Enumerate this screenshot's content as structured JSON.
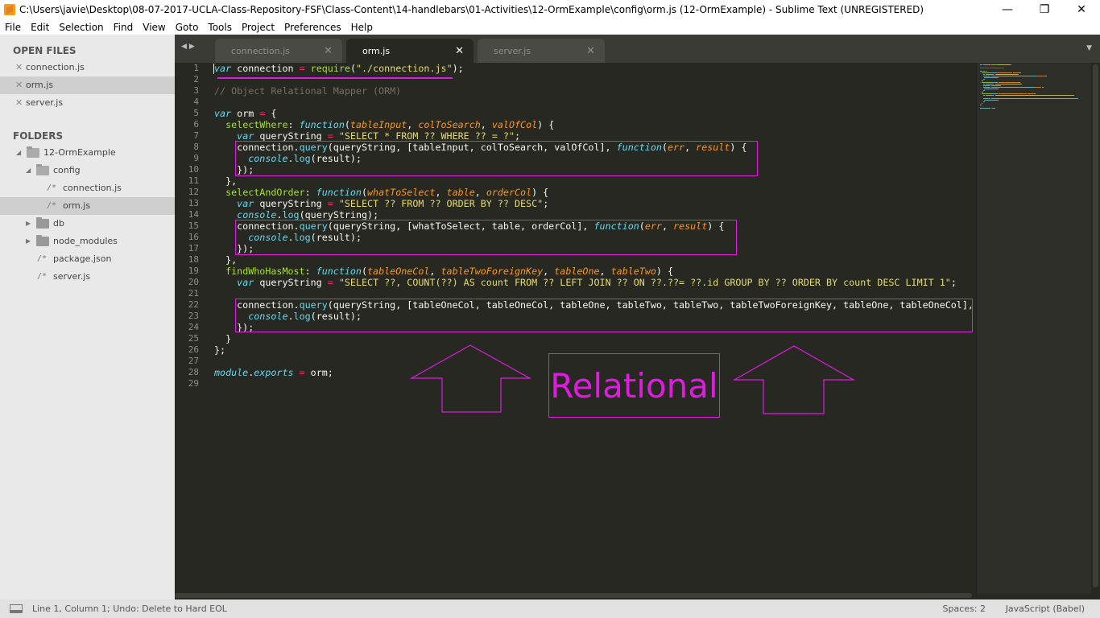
{
  "window": {
    "title": "C:\\Users\\javie\\Desktop\\08-07-2017-UCLA-Class-Repository-FSF\\Class-Content\\14-handlebars\\01-Activities\\12-OrmExample\\config\\orm.js (12-OrmExample) - Sublime Text (UNREGISTERED)",
    "minimize": "—",
    "restore": "❐",
    "close": "✕"
  },
  "menu": [
    "File",
    "Edit",
    "Selection",
    "Find",
    "View",
    "Goto",
    "Tools",
    "Project",
    "Preferences",
    "Help"
  ],
  "sidebar": {
    "open_files_header": "OPEN FILES",
    "open_files": [
      {
        "name": "connection.js",
        "selected": false
      },
      {
        "name": "orm.js",
        "selected": true
      },
      {
        "name": "server.js",
        "selected": false
      }
    ],
    "folders_header": "FOLDERS",
    "tree": [
      {
        "name": "12-OrmExample",
        "type": "folder-open",
        "depth": 0,
        "selected": false
      },
      {
        "name": "config",
        "type": "folder-open",
        "depth": 1,
        "selected": false
      },
      {
        "name": "connection.js",
        "type": "file",
        "depth": 2,
        "selected": false
      },
      {
        "name": "orm.js",
        "type": "file",
        "depth": 2,
        "selected": true
      },
      {
        "name": "db",
        "type": "folder-closed",
        "depth": 1,
        "selected": false
      },
      {
        "name": "node_modules",
        "type": "folder-closed",
        "depth": 1,
        "selected": false
      },
      {
        "name": "package.json",
        "type": "file",
        "depth": 1,
        "selected": false
      },
      {
        "name": "server.js",
        "type": "file",
        "depth": 1,
        "selected": false
      }
    ],
    "close_glyph": "✕",
    "file_glyph": "/*"
  },
  "tabs": [
    {
      "label": "connection.js",
      "active": false
    },
    {
      "label": "orm.js",
      "active": true
    },
    {
      "label": "server.js",
      "active": false
    }
  ],
  "tab_close_glyph": "✕",
  "nav_arrows": "◀▶",
  "tab_menu_glyph": "▼",
  "editor": {
    "line_numbers": [
      "1",
      "2",
      "3",
      "4",
      "5",
      "6",
      "7",
      "8",
      "9",
      "10",
      "11",
      "12",
      "13",
      "14",
      "15",
      "16",
      "17",
      "18",
      "19",
      "20",
      "21",
      "22",
      "23",
      "24",
      "25",
      "26",
      "27",
      "28",
      "29"
    ],
    "code": [
      [
        [
          "kw",
          "var"
        ],
        [
          "t",
          " connection "
        ],
        [
          "op",
          "="
        ],
        [
          "t",
          " "
        ],
        [
          "fn",
          "require"
        ],
        [
          "t",
          "("
        ],
        [
          "str",
          "\"./connection.js\""
        ],
        [
          "t",
          ");"
        ]
      ],
      [],
      [
        [
          "cmt",
          "// Object Relational Mapper (ORM)"
        ]
      ],
      [],
      [
        [
          "kw",
          "var"
        ],
        [
          "t",
          " orm "
        ],
        [
          "op",
          "="
        ],
        [
          "t",
          " {"
        ]
      ],
      [
        [
          "t",
          "  "
        ],
        [
          "fn",
          "selectWhere"
        ],
        [
          "t",
          ": "
        ],
        [
          "kw",
          "function"
        ],
        [
          "t",
          "("
        ],
        [
          "prm",
          "tableInput"
        ],
        [
          "t",
          ", "
        ],
        [
          "prm",
          "colToSearch"
        ],
        [
          "t",
          ", "
        ],
        [
          "prm",
          "valOfCol"
        ],
        [
          "t",
          ") {"
        ]
      ],
      [
        [
          "t",
          "    "
        ],
        [
          "kw",
          "var"
        ],
        [
          "t",
          " queryString "
        ],
        [
          "op",
          "="
        ],
        [
          "t",
          " "
        ],
        [
          "str",
          "\"SELECT * FROM ?? WHERE ?? = ?\""
        ],
        [
          "t",
          ";"
        ]
      ],
      [
        [
          "t",
          "    connection."
        ],
        [
          "mth",
          "query"
        ],
        [
          "t",
          "(queryString, [tableInput, colToSearch, valOfCol], "
        ],
        [
          "kw",
          "function"
        ],
        [
          "t",
          "("
        ],
        [
          "prm",
          "err"
        ],
        [
          "t",
          ", "
        ],
        [
          "prm",
          "result"
        ],
        [
          "t",
          ") {"
        ]
      ],
      [
        [
          "t",
          "      "
        ],
        [
          "sup",
          "console"
        ],
        [
          "t",
          "."
        ],
        [
          "mth",
          "log"
        ],
        [
          "t",
          "(result);"
        ]
      ],
      [
        [
          "t",
          "    });"
        ]
      ],
      [
        [
          "t",
          "  },"
        ]
      ],
      [
        [
          "t",
          "  "
        ],
        [
          "fn",
          "selectAndOrder"
        ],
        [
          "t",
          ": "
        ],
        [
          "kw",
          "function"
        ],
        [
          "t",
          "("
        ],
        [
          "prm",
          "whatToSelect"
        ],
        [
          "t",
          ", "
        ],
        [
          "prm",
          "table"
        ],
        [
          "t",
          ", "
        ],
        [
          "prm",
          "orderCol"
        ],
        [
          "t",
          ") {"
        ]
      ],
      [
        [
          "t",
          "    "
        ],
        [
          "kw",
          "var"
        ],
        [
          "t",
          " queryString "
        ],
        [
          "op",
          "="
        ],
        [
          "t",
          " "
        ],
        [
          "str",
          "\"SELECT ?? FROM ?? ORDER BY ?? DESC\""
        ],
        [
          "t",
          ";"
        ]
      ],
      [
        [
          "t",
          "    "
        ],
        [
          "sup",
          "console"
        ],
        [
          "t",
          "."
        ],
        [
          "mth",
          "log"
        ],
        [
          "t",
          "(queryString);"
        ]
      ],
      [
        [
          "t",
          "    connection."
        ],
        [
          "mth",
          "query"
        ],
        [
          "t",
          "(queryString, [whatToSelect, table, orderCol], "
        ],
        [
          "kw",
          "function"
        ],
        [
          "t",
          "("
        ],
        [
          "prm",
          "err"
        ],
        [
          "t",
          ", "
        ],
        [
          "prm",
          "result"
        ],
        [
          "t",
          ") {"
        ]
      ],
      [
        [
          "t",
          "      "
        ],
        [
          "sup",
          "console"
        ],
        [
          "t",
          "."
        ],
        [
          "mth",
          "log"
        ],
        [
          "t",
          "(result);"
        ]
      ],
      [
        [
          "t",
          "    });"
        ]
      ],
      [
        [
          "t",
          "  },"
        ]
      ],
      [
        [
          "t",
          "  "
        ],
        [
          "fn",
          "findWhoHasMost"
        ],
        [
          "t",
          ": "
        ],
        [
          "kw",
          "function"
        ],
        [
          "t",
          "("
        ],
        [
          "prm",
          "tableOneCol"
        ],
        [
          "t",
          ", "
        ],
        [
          "prm",
          "tableTwoForeignKey"
        ],
        [
          "t",
          ", "
        ],
        [
          "prm",
          "tableOne"
        ],
        [
          "t",
          ", "
        ],
        [
          "prm",
          "tableTwo"
        ],
        [
          "t",
          ") {"
        ]
      ],
      [
        [
          "t",
          "    "
        ],
        [
          "kw",
          "var"
        ],
        [
          "t",
          " queryString "
        ],
        [
          "op",
          "="
        ],
        [
          "t",
          " "
        ],
        [
          "str",
          "\"SELECT ??, COUNT(??) AS count FROM ?? LEFT JOIN ?? ON ??.??= ??.id GROUP BY ?? ORDER BY count DESC LIMIT 1\""
        ],
        [
          "t",
          ";"
        ]
      ],
      [],
      [
        [
          "t",
          "    connection."
        ],
        [
          "mth",
          "query"
        ],
        [
          "t",
          "(queryString, [tableOneCol, tableOneCol, tableOne, tableTwo, tableTwo, tableTwoForeignKey, tableOne, tableOneCol], "
        ],
        [
          "kw",
          "f"
        ]
      ],
      [
        [
          "t",
          "      "
        ],
        [
          "sup",
          "console"
        ],
        [
          "t",
          "."
        ],
        [
          "mth",
          "log"
        ],
        [
          "t",
          "(result);"
        ]
      ],
      [
        [
          "t",
          "    });"
        ]
      ],
      [
        [
          "t",
          "  }"
        ]
      ],
      [
        [
          "t",
          "};"
        ]
      ],
      [],
      [
        [
          "sup",
          "module"
        ],
        [
          "t",
          "."
        ],
        [
          "sup",
          "exports"
        ],
        [
          "t",
          " "
        ],
        [
          "op",
          "="
        ],
        [
          "t",
          " orm;"
        ]
      ],
      []
    ]
  },
  "annotation": {
    "label": "Relational",
    "color": "#e01be0"
  },
  "status": {
    "text": "Line 1, Column 1; Undo: Delete to Hard EOL",
    "spaces": "Spaces: 2",
    "syntax": "JavaScript (Babel)"
  }
}
